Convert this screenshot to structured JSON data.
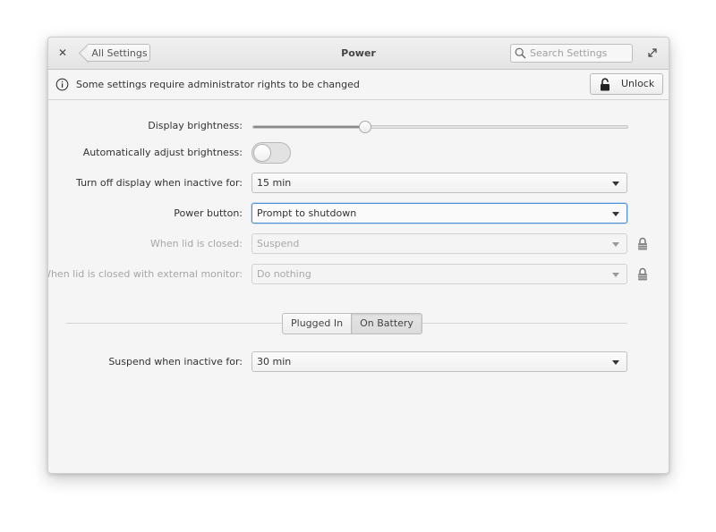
{
  "window": {
    "title": "Power"
  },
  "header": {
    "back_label": "All Settings",
    "search_placeholder": "Search Settings"
  },
  "infobar": {
    "message": "Some settings require administrator rights to be changed",
    "unlock_label": "Unlock"
  },
  "settings": {
    "brightness": {
      "label": "Display brightness:",
      "level": 0.3
    },
    "auto_brightness": {
      "label": "Automatically adjust brightness:",
      "enabled": false
    },
    "display_off": {
      "label": "Turn off display when inactive for:",
      "value": "15 min"
    },
    "power_button": {
      "label": "Power button:",
      "value": "Prompt to shutdown"
    },
    "lid_closed": {
      "label": "When lid is closed:",
      "value": "Suspend"
    },
    "lid_closed_external": {
      "label": "When lid is closed with external monitor:",
      "value": "Do nothing"
    }
  },
  "power_source": {
    "options": [
      "Plugged In",
      "On Battery"
    ],
    "selected": "On Battery"
  },
  "suspend": {
    "label": "Suspend when inactive for:",
    "value": "30 min"
  },
  "colors": {
    "focus_accent": "#4a90d9",
    "slider_fill": "#8a8a8a"
  }
}
